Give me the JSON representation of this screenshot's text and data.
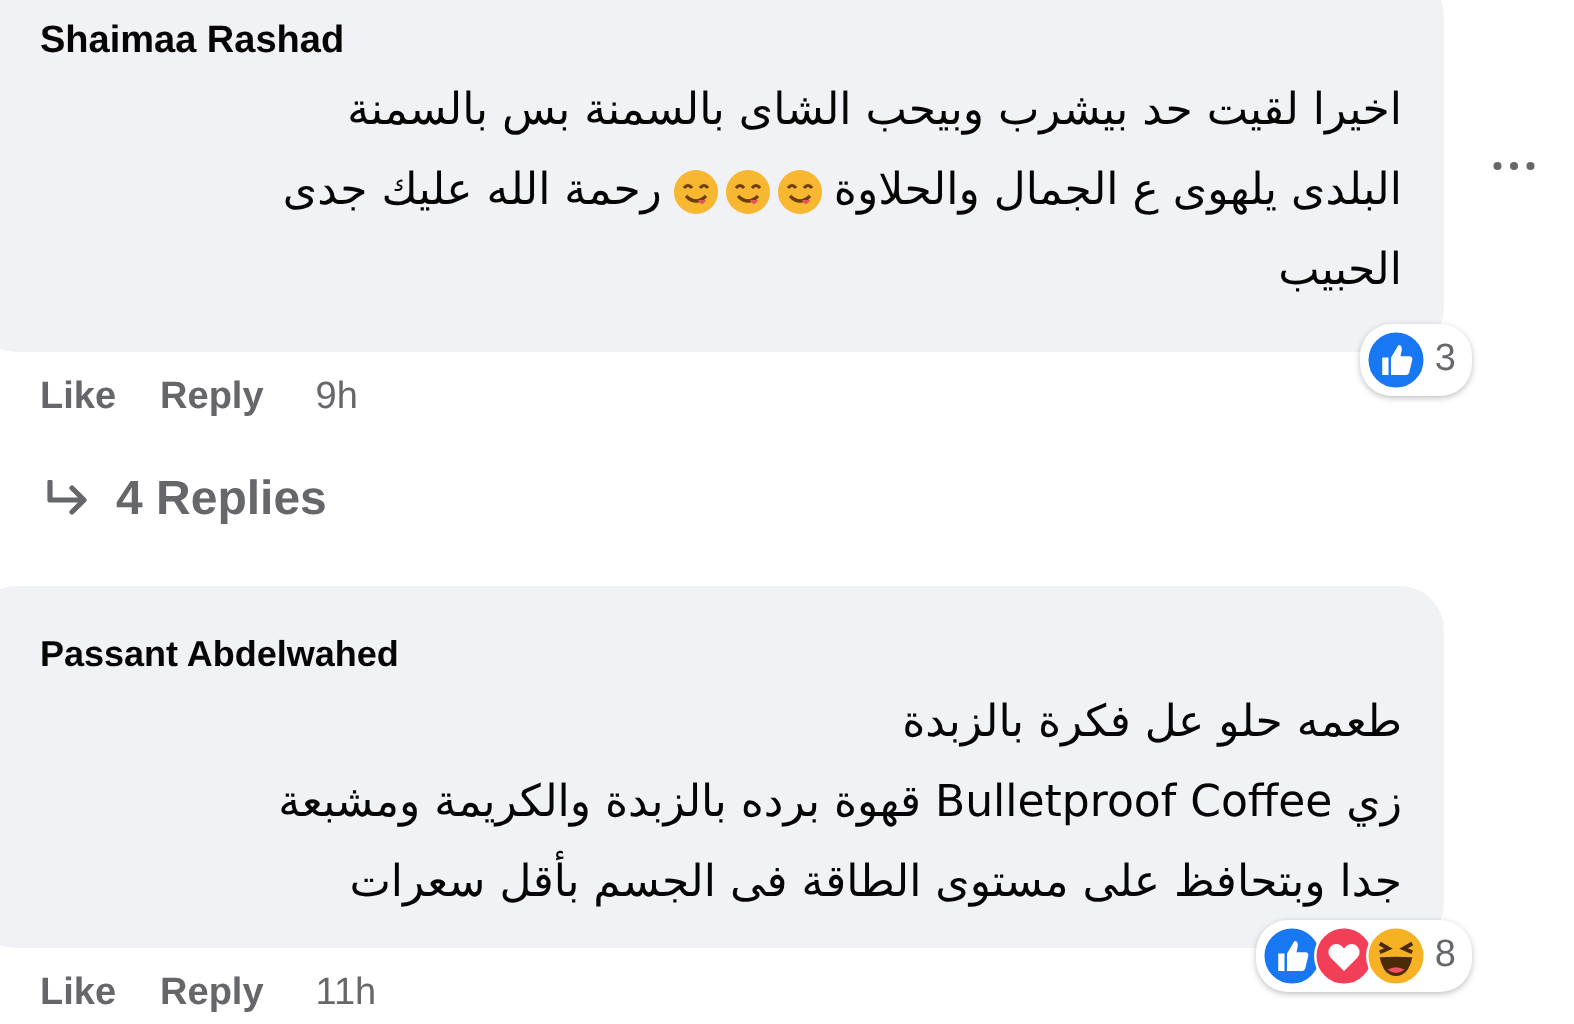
{
  "comments": [
    {
      "author": "Shaimaa Rashad",
      "body": [
        [
          {
            "kind": "text",
            "text": "اخيرا لقيت حد بيشرب وبيحب الشاى بالسمنة بس بالسمنة"
          }
        ],
        [
          {
            "kind": "text",
            "text": "البلدى يلهوى ع الجمال والحلاوة"
          },
          {
            "kind": "emoji"
          },
          {
            "kind": "emoji"
          },
          {
            "kind": "emoji"
          },
          {
            "kind": "text",
            "text": "رحمة الله عليك جدى"
          }
        ],
        [
          {
            "kind": "text",
            "text": "الحبيب"
          }
        ]
      ],
      "reactions": [
        {
          "kind": "like"
        }
      ],
      "reaction_count": "3",
      "like_label": "Like",
      "reply_label": "Reply",
      "time": "9h",
      "more": true,
      "replies": "4 Replies"
    },
    {
      "author": "Passant Abdelwahed",
      "body": [
        [
          {
            "kind": "text",
            "text": "طعمه حلو عل فكرة بالزبدة"
          }
        ],
        [
          {
            "kind": "text",
            "text": "زي Bulletproof Coffee قهوة برده بالزبدة والكريمة ومشبعة"
          }
        ],
        [
          {
            "kind": "text",
            "text": "جدا وبتحافظ على مستوى الطاقة فى الجسم بأقل سعرات"
          }
        ]
      ],
      "reactions": [
        {
          "kind": "like"
        },
        {
          "kind": "love"
        },
        {
          "kind": "haha"
        }
      ],
      "reaction_count": "8",
      "like_label": "Like",
      "reply_label": "Reply",
      "time": "11h",
      "more": false
    }
  ]
}
